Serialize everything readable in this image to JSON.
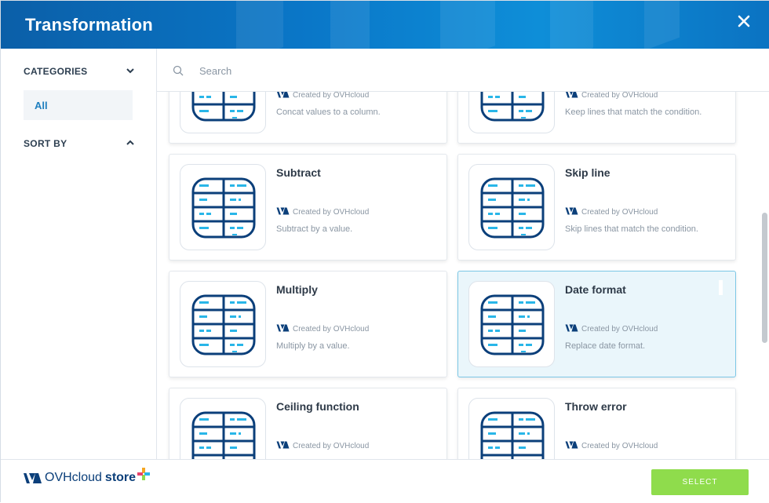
{
  "header": {
    "title": "Transformation"
  },
  "sidebar": {
    "categories_label": "CATEGORIES",
    "active_category": "All",
    "sort_label": "SORT BY"
  },
  "search": {
    "placeholder": "Search",
    "value": ""
  },
  "cards": [
    {
      "name": "",
      "creator": "Created by OVHcloud",
      "desc": "Concat values to a column.",
      "selected": false
    },
    {
      "name": "",
      "creator": "Created by OVHcloud",
      "desc": "Keep lines that match the condition.",
      "selected": false
    },
    {
      "name": "Subtract",
      "creator": "Created by OVHcloud",
      "desc": "Subtract by a value.",
      "selected": false
    },
    {
      "name": "Skip line",
      "creator": "Created by OVHcloud",
      "desc": "Skip lines that match the condition.",
      "selected": false
    },
    {
      "name": "Multiply",
      "creator": "Created by OVHcloud",
      "desc": "Multiply by a value.",
      "selected": false
    },
    {
      "name": "Date format",
      "creator": "Created by OVHcloud",
      "desc": "Replace date format.",
      "selected": true
    },
    {
      "name": "Ceiling function",
      "creator": "Created by OVHcloud",
      "desc": "",
      "selected": false
    },
    {
      "name": "Throw error",
      "creator": "Created by OVHcloud",
      "desc": "",
      "selected": false
    }
  ],
  "footer": {
    "brand_name": "OVHcloud",
    "brand_suffix": "store",
    "select_label": "SELECT"
  },
  "colors": {
    "header_blue": "#0a77c8",
    "accent_green": "#8fdc4c",
    "selected_bg": "#eaf6fb",
    "icon_navy": "#0b3f7a",
    "icon_cyan": "#29b6e8"
  }
}
